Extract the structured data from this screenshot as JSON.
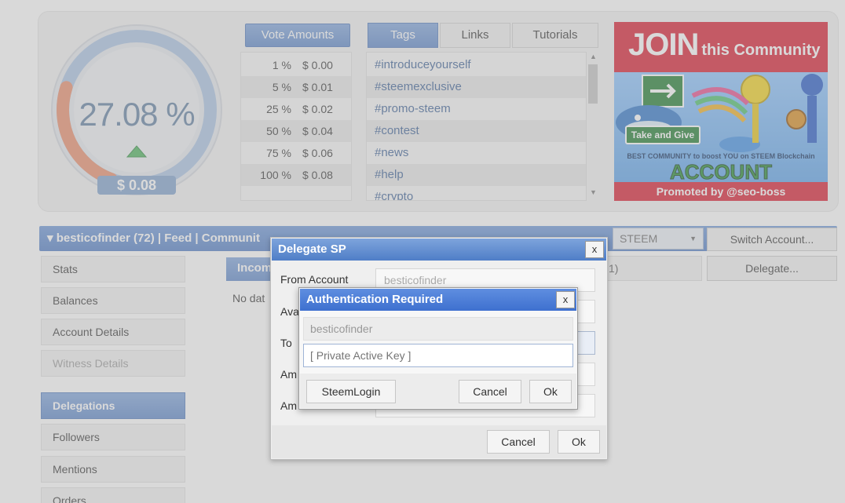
{
  "gauge": {
    "value": "27.08 %",
    "money": "$ 0.08",
    "level_fraction": 0.2708
  },
  "vote_amounts": {
    "title": "Vote Amounts",
    "rows": [
      {
        "pct": "1 %",
        "amt": "$ 0.00"
      },
      {
        "pct": "5 %",
        "amt": "$ 0.01"
      },
      {
        "pct": "25 %",
        "amt": "$ 0.02"
      },
      {
        "pct": "50 %",
        "amt": "$ 0.04"
      },
      {
        "pct": "75 %",
        "amt": "$ 0.06"
      },
      {
        "pct": "100 %",
        "amt": "$ 0.08"
      }
    ]
  },
  "tag_tabs": {
    "tags": "Tags",
    "links": "Links",
    "tutorials": "Tutorials"
  },
  "tags": [
    "#introduceyourself",
    "#steemexclusive",
    "#promo-steem",
    "#contest",
    "#news",
    "#help",
    "#crypto"
  ],
  "banner": {
    "join": "JOIN",
    "community": "this Community",
    "take_give": "Take and Give",
    "tagline": "BEST COMMUNITY to boost YOU on STEEM Blockchain",
    "booster": "ACCOUNT BOOSTER",
    "promoted": "Promoted by @seo-boss"
  },
  "account_bar": {
    "text": "▾ besticofinder (72)  |  Feed  |  Communit",
    "currency": "STEEM",
    "switch": "Switch Account..."
  },
  "sidebar": {
    "items": [
      "Stats",
      "Balances",
      "Account Details",
      "Witness Details",
      "Delegations",
      "Followers",
      "Mentions",
      "Orders"
    ]
  },
  "main": {
    "incoming_tab": "Incom",
    "right_strip": "1)",
    "delegate_button": "Delegate...",
    "no_data": "No dat"
  },
  "delegate_dialog": {
    "title": "Delegate SP",
    "close": "x",
    "from_label": "From Account",
    "from_value": "besticofinder",
    "label_2": "Ava",
    "label_3": "To",
    "label_4": "Am",
    "label_5": "Am",
    "cancel": "Cancel",
    "ok": "Ok"
  },
  "auth_dialog": {
    "title": "Authentication Required",
    "close": "x",
    "username": "besticofinder",
    "key_placeholder": "[ Private Active Key ]",
    "steemlogin": "SteemLogin",
    "cancel": "Cancel",
    "ok": "Ok"
  },
  "colors": {
    "accent": "#5b86c9",
    "gauge_fill": "#e98a6a",
    "gauge_track": "#9dbbe0"
  }
}
